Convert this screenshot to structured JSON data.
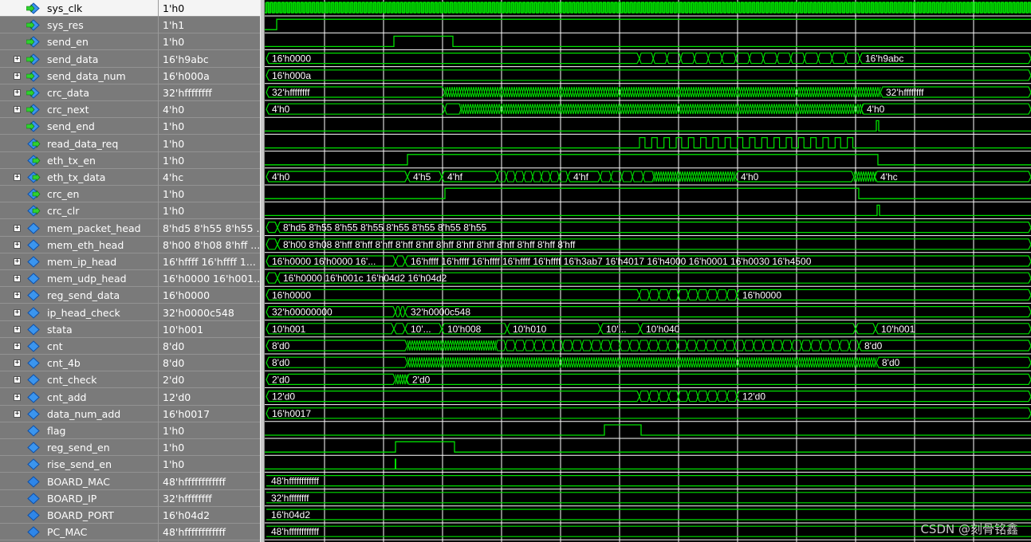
{
  "colors": {
    "wave": "#00e000",
    "grid": "#ffffff",
    "label": "#ffffff",
    "panel": "#7a7a7a",
    "selected": "#f4f4f4"
  },
  "signals": [
    {
      "name": "sys_clk",
      "value": "1'h0",
      "expand": false,
      "icon": "input-signal-icon",
      "kind": "clk",
      "selected": true
    },
    {
      "name": "sys_res",
      "value": "1'h1",
      "expand": false,
      "icon": "input-signal-icon",
      "kind": "bit",
      "init": 0,
      "edges": [
        {
          "t": 15,
          "v": 1
        }
      ]
    },
    {
      "name": "send_en",
      "value": "1'h0",
      "expand": false,
      "icon": "input-signal-icon",
      "kind": "bit",
      "init": 0,
      "edges": [
        {
          "t": 162,
          "v": 1
        },
        {
          "t": 236,
          "v": 0
        }
      ]
    },
    {
      "name": "send_data",
      "value": "16'h9abc",
      "expand": true,
      "icon": "input-signal-icon",
      "kind": "bus",
      "segs": [
        {
          "t": 2,
          "l": "16'h0000"
        },
        {
          "t": 470,
          "l": "",
          "burst": 16
        },
        {
          "t": 746,
          "l": "16'h9abc"
        }
      ]
    },
    {
      "name": "send_data_num",
      "value": "16'h000a",
      "expand": true,
      "icon": "input-signal-icon",
      "kind": "bus",
      "segs": [
        {
          "t": 2,
          "l": "16'h000a"
        }
      ]
    },
    {
      "name": "crc_data",
      "value": "32'hffffffff",
      "expand": true,
      "icon": "input-signal-icon",
      "kind": "bus",
      "segs": [
        {
          "t": 2,
          "l": "32'hffffffff"
        },
        {
          "t": 226,
          "l": "",
          "dense": true
        },
        {
          "t": 772,
          "l": "32'hffffffff"
        }
      ]
    },
    {
      "name": "crc_next",
      "value": "4'h0",
      "expand": true,
      "icon": "input-signal-icon",
      "kind": "bus",
      "segs": [
        {
          "t": 2,
          "l": "4'h0"
        },
        {
          "t": 226,
          "l": "",
          "burst": 1
        },
        {
          "t": 246,
          "l": "",
          "dense": true
        },
        {
          "t": 748,
          "l": "4'h0"
        }
      ]
    },
    {
      "name": "send_end",
      "value": "1'h0",
      "expand": false,
      "icon": "input-signal-icon",
      "kind": "bit",
      "init": 0,
      "edges": [
        {
          "t": 767,
          "v": 1
        },
        {
          "t": 770,
          "v": 0
        }
      ]
    },
    {
      "name": "read_data_req",
      "value": "1'h0",
      "expand": false,
      "icon": "output-signal-icon",
      "kind": "pulses",
      "from": 470,
      "to": 746,
      "count": 18
    },
    {
      "name": "eth_tx_en",
      "value": "1'h0",
      "expand": false,
      "icon": "output-signal-icon",
      "kind": "bit",
      "init": 0,
      "edges": [
        {
          "t": 179,
          "v": 1
        },
        {
          "t": 769,
          "v": 0
        }
      ]
    },
    {
      "name": "eth_tx_data",
      "value": "4'hc",
      "expand": true,
      "icon": "output-signal-icon",
      "kind": "bus",
      "segs": [
        {
          "t": 2,
          "l": "4'h0"
        },
        {
          "t": 179,
          "l": "4'h5"
        },
        {
          "t": 222,
          "l": "4'hf"
        },
        {
          "t": 292,
          "l": "",
          "burst": 8
        },
        {
          "t": 380,
          "l": "4'hf"
        },
        {
          "t": 421,
          "l": "",
          "burst": 5
        },
        {
          "t": 488,
          "l": "",
          "dense": true
        },
        {
          "t": 590,
          "l": "4'h0"
        },
        {
          "t": 739,
          "l": "",
          "dense": true
        },
        {
          "t": 765,
          "l": "4'hc"
        }
      ]
    },
    {
      "name": "crc_en",
      "value": "1'h0",
      "expand": false,
      "icon": "output-signal-icon",
      "kind": "bit",
      "init": 0,
      "edges": [
        {
          "t": 226,
          "v": 1
        },
        {
          "t": 745,
          "v": 0
        }
      ]
    },
    {
      "name": "crc_clr",
      "value": "1'h0",
      "expand": false,
      "icon": "output-signal-icon",
      "kind": "bit",
      "init": 0,
      "edges": [
        {
          "t": 768,
          "v": 1
        },
        {
          "t": 771,
          "v": 0
        }
      ]
    },
    {
      "name": "mem_packet_head",
      "value": "8'hd5 8'h55 8'h55 ...",
      "expand": true,
      "icon": "internal-signal-icon",
      "kind": "bus",
      "segs": [
        {
          "t": 2,
          "l": ""
        },
        {
          "t": 16,
          "l": "8'hd5 8'h55 8'h55 8'h55 8'h55 8'h55 8'h55 8'h55"
        }
      ]
    },
    {
      "name": "mem_eth_head",
      "value": "8'h00 8'h08 8'hff ...",
      "expand": true,
      "icon": "internal-signal-icon",
      "kind": "bus",
      "segs": [
        {
          "t": 2,
          "l": ""
        },
        {
          "t": 16,
          "l": "8'h00 8'h08 8'hff 8'hff 8'hff 8'hff 8'hff 8'hff 8'hff 8'hff 8'hff 8'hff 8'hff 8'hff"
        }
      ]
    },
    {
      "name": "mem_ip_head",
      "value": "16'hffff 16'hffff 1...",
      "expand": true,
      "icon": "internal-signal-icon",
      "kind": "bus",
      "segs": [
        {
          "t": 2,
          "l": "16'h0000 16'h0000 16'..."
        },
        {
          "t": 164,
          "l": ""
        },
        {
          "t": 176,
          "l": "16'hffff 16'hffff 16'hffff 16'hffff 16'hffff 16'h3ab7 16'h4017 16'h4000 16'h0001 16'h0030 16'h4500"
        }
      ]
    },
    {
      "name": "mem_udp_head",
      "value": "16'h0000 16'h001...",
      "expand": true,
      "icon": "internal-signal-icon",
      "kind": "bus",
      "segs": [
        {
          "t": 2,
          "l": ""
        },
        {
          "t": 16,
          "l": "16'h0000 16'h001c 16'h04d2 16'h04d2"
        }
      ]
    },
    {
      "name": "reg_send_data",
      "value": "16'h0000",
      "expand": true,
      "icon": "internal-signal-icon",
      "kind": "bus",
      "segs": [
        {
          "t": 2,
          "l": "16'h0000"
        },
        {
          "t": 470,
          "l": "",
          "burst": 10
        },
        {
          "t": 592,
          "l": "16'h0000"
        }
      ]
    },
    {
      "name": "ip_head_check",
      "value": "32'h0000c548",
      "expand": true,
      "icon": "internal-signal-icon",
      "kind": "bus",
      "segs": [
        {
          "t": 2,
          "l": "32'h00000000"
        },
        {
          "t": 164,
          "l": "",
          "burst": 2
        },
        {
          "t": 176,
          "l": "32'h0000c548"
        }
      ]
    },
    {
      "name": "stata",
      "value": "10'h001",
      "expand": true,
      "icon": "internal-signal-icon",
      "kind": "bus",
      "segs": [
        {
          "t": 2,
          "l": "10'h001"
        },
        {
          "t": 162,
          "l": ""
        },
        {
          "t": 176,
          "l": "10'..."
        },
        {
          "t": 222,
          "l": "10'h008"
        },
        {
          "t": 304,
          "l": "10'h010"
        },
        {
          "t": 421,
          "l": "10'..."
        },
        {
          "t": 471,
          "l": "10'h040"
        },
        {
          "t": 741,
          "l": ""
        },
        {
          "t": 766,
          "l": "10'h001"
        }
      ]
    },
    {
      "name": "cnt",
      "value": "8'd0",
      "expand": true,
      "icon": "internal-signal-icon",
      "kind": "bus",
      "segs": [
        {
          "t": 2,
          "l": "8'd0"
        },
        {
          "t": 179,
          "l": "",
          "dense": true
        },
        {
          "t": 290,
          "l": "",
          "burst": 38
        },
        {
          "t": 745,
          "l": "8'd0"
        }
      ]
    },
    {
      "name": "cnt_4b",
      "value": "8'd0",
      "expand": true,
      "icon": "internal-signal-icon",
      "kind": "bus",
      "segs": [
        {
          "t": 2,
          "l": "8'd0"
        },
        {
          "t": 179,
          "l": "",
          "dense": true
        },
        {
          "t": 767,
          "l": "8'd0"
        }
      ]
    },
    {
      "name": "cnt_check",
      "value": "2'd0",
      "expand": true,
      "icon": "internal-signal-icon",
      "kind": "bus",
      "segs": [
        {
          "t": 2,
          "l": "2'd0"
        },
        {
          "t": 164,
          "l": "",
          "dense": true
        },
        {
          "t": 178,
          "l": "2'd0"
        }
      ]
    },
    {
      "name": "cnt_add",
      "value": "12'd0",
      "expand": true,
      "icon": "internal-signal-icon",
      "kind": "bus",
      "segs": [
        {
          "t": 2,
          "l": "12'd0"
        },
        {
          "t": 470,
          "l": "",
          "burst": 10
        },
        {
          "t": 592,
          "l": "12'd0"
        }
      ]
    },
    {
      "name": "data_num_add",
      "value": "16'h0017",
      "expand": true,
      "icon": "internal-signal-icon",
      "kind": "bus",
      "segs": [
        {
          "t": 2,
          "l": "16'h0017"
        }
      ]
    },
    {
      "name": "flag",
      "value": "1'h0",
      "expand": false,
      "icon": "internal-signal-icon",
      "kind": "bit",
      "init": 0,
      "edges": [
        {
          "t": 426,
          "v": 1
        },
        {
          "t": 472,
          "v": 0
        }
      ]
    },
    {
      "name": "reg_send_en",
      "value": "1'h0",
      "expand": false,
      "icon": "internal-signal-icon",
      "kind": "bit",
      "init": 0,
      "edges": [
        {
          "t": 164,
          "v": 1
        },
        {
          "t": 238,
          "v": 0
        }
      ]
    },
    {
      "name": "rise_send_en",
      "value": "1'h0",
      "expand": false,
      "icon": "internal-signal-icon",
      "kind": "spike",
      "t": 164
    },
    {
      "name": "BOARD_MAC",
      "value": "48'hffffffffffff",
      "expand": false,
      "icon": "parameter-icon",
      "kind": "const",
      "label": "48'hffffffffffff"
    },
    {
      "name": "BOARD_IP",
      "value": "32'hffffffff",
      "expand": false,
      "icon": "parameter-icon",
      "kind": "const",
      "label": "32'hffffffff"
    },
    {
      "name": "BOARD_PORT",
      "value": "16'h04d2",
      "expand": false,
      "icon": "parameter-icon",
      "kind": "const",
      "label": "16'h04d2"
    },
    {
      "name": "PC_MAC",
      "value": "48'hffffffffffff",
      "expand": false,
      "icon": "parameter-icon",
      "kind": "const",
      "label": "48'hffffffffffff"
    }
  ],
  "watermark": "CSDN @刻骨铭鑫"
}
